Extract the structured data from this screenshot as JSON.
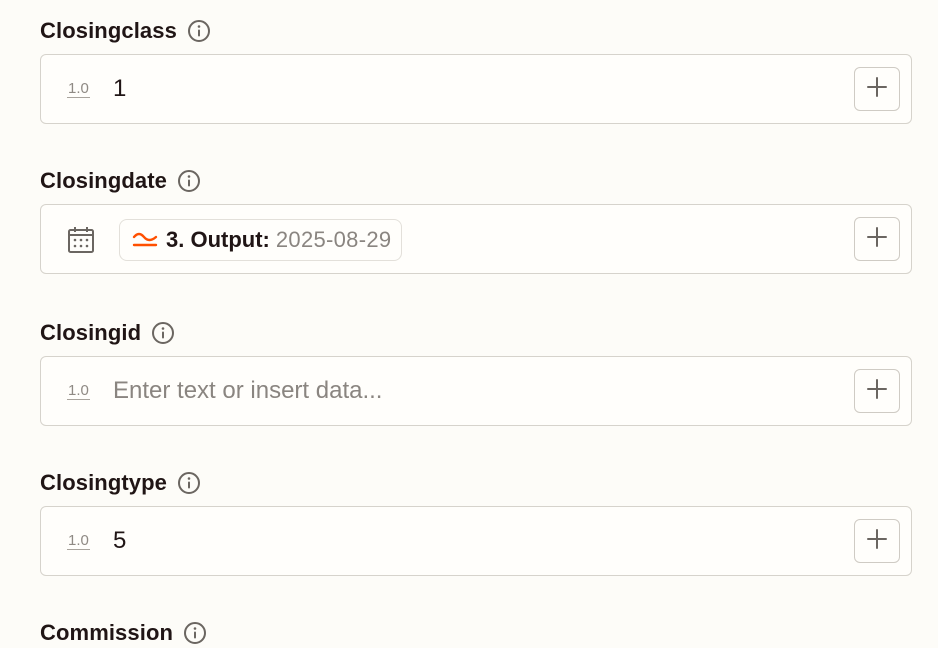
{
  "fields": [
    {
      "label": "Closingclass",
      "type_badge": "1.0",
      "value": "1",
      "placeholder": ""
    },
    {
      "label": "Closingdate",
      "pill": {
        "step": "3. Output:",
        "value": "2025-08-29"
      }
    },
    {
      "label": "Closingid",
      "type_badge": "1.0",
      "value": "",
      "placeholder": "Enter text or insert data..."
    },
    {
      "label": "Closingtype",
      "type_badge": "1.0",
      "value": "5",
      "placeholder": ""
    },
    {
      "label": "Commission"
    }
  ],
  "icons": {
    "info": "info-icon",
    "plus": "plus-icon",
    "calendar": "calendar-icon",
    "step_output": "transform-output-icon"
  },
  "colors": {
    "background": "#fdfcf8",
    "border": "#d6d3cc",
    "accent_orange": "#ff4f00",
    "text": "#201515",
    "muted": "#8a8580"
  }
}
